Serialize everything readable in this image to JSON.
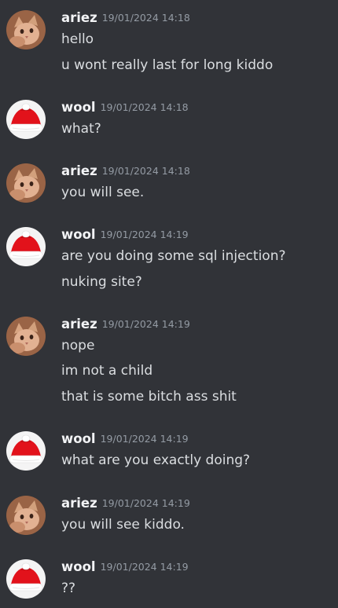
{
  "users": {
    "ariez": {
      "name": "ariez",
      "avatar_icon": "cat-avatar-icon"
    },
    "wool": {
      "name": "wool",
      "avatar_icon": "santa-hat-avatar-icon"
    }
  },
  "messages": [
    {
      "author": "ariez",
      "timestamp": "19/01/2024 14:18",
      "lines": [
        "hello",
        "u wont really last for long kiddo"
      ]
    },
    {
      "author": "wool",
      "timestamp": "19/01/2024 14:18",
      "lines": [
        "what?"
      ]
    },
    {
      "author": "ariez",
      "timestamp": "19/01/2024 14:18",
      "lines": [
        "you will see."
      ]
    },
    {
      "author": "wool",
      "timestamp": "19/01/2024 14:19",
      "lines": [
        "are you doing some sql injection?",
        "nuking site?"
      ]
    },
    {
      "author": "ariez",
      "timestamp": "19/01/2024 14:19",
      "lines": [
        "nope",
        "im not a child",
        "that is some bitch ass shit"
      ]
    },
    {
      "author": "wool",
      "timestamp": "19/01/2024 14:19",
      "lines": [
        "what are you exactly doing?"
      ]
    },
    {
      "author": "ariez",
      "timestamp": "19/01/2024 14:19",
      "lines": [
        "you will see kiddo."
      ]
    },
    {
      "author": "wool",
      "timestamp": "19/01/2024 14:19",
      "lines": [
        "??"
      ]
    }
  ]
}
